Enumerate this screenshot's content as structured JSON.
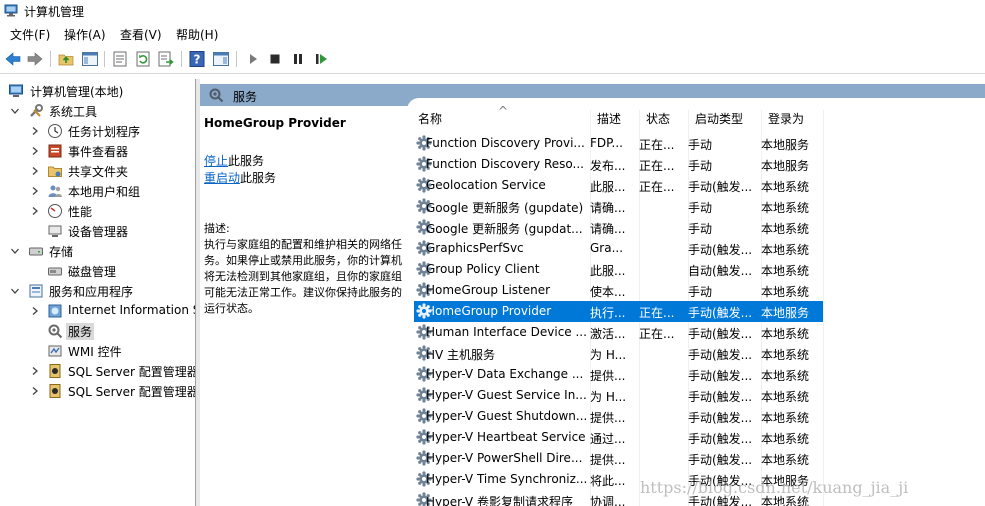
{
  "window": {
    "title": "计算机管理",
    "icon": "computer-management-icon"
  },
  "menu": [
    "文件(F)",
    "操作(A)",
    "查看(V)",
    "帮助(H)"
  ],
  "toolbar_icons": [
    "back-arrow-icon",
    "forward-arrow-icon",
    "up-folder-icon",
    "show-tree-icon",
    "properties-icon",
    "refresh-icon",
    "export-icon",
    "help-icon",
    "show-action-pane-icon",
    "play-icon",
    "stop-icon",
    "pause-icon",
    "resume-icon"
  ],
  "tree": {
    "root": "计算机管理(本地)",
    "system_tools": "系统工具",
    "task_scheduler": "任务计划程序",
    "event_viewer": "事件查看器",
    "shared_folders": "共享文件夹",
    "local_users": "本地用户和组",
    "performance": "性能",
    "device_manager": "设备管理器",
    "storage": "存储",
    "disk_management": "磁盘管理",
    "services_apps": "服务和应用程序",
    "iis": "Internet Information Services",
    "services": "服务",
    "wmi": "WMI 控件",
    "sql1": "SQL Server 配置管理器",
    "sql2": "SQL Server 配置管理器"
  },
  "band_title": "服务",
  "detail": {
    "service_name": "HomeGroup Provider",
    "stop_link": "停止",
    "stop_suffix": "此服务",
    "restart_link": "重启动",
    "restart_suffix": "此服务",
    "desc_label": "描述:",
    "desc_text": "执行与家庭组的配置和维护相关的网络任务。如果停止或禁用此服务，你的计算机将无法检测到其他家庭组，且你的家庭组可能无法正常工作。建议你保持此服务的运行状态。"
  },
  "columns": [
    "名称",
    "描述",
    "状态",
    "启动类型",
    "登录为"
  ],
  "sort_indicator": "^",
  "rows": [
    {
      "name": "Function Discovery Provi...",
      "desc": "FDP...",
      "status": "正在...",
      "startup": "手动",
      "logon": "本地服务"
    },
    {
      "name": "Function Discovery Reso...",
      "desc": "发布...",
      "status": "正在...",
      "startup": "手动",
      "logon": "本地服务"
    },
    {
      "name": "Geolocation Service",
      "desc": "此服...",
      "status": "正在...",
      "startup": "手动(触发...",
      "logon": "本地系统"
    },
    {
      "name": "Google 更新服务 (gupdate)",
      "desc": "请确...",
      "status": "",
      "startup": "手动",
      "logon": "本地系统"
    },
    {
      "name": "Google 更新服务 (gupdat...",
      "desc": "请确...",
      "status": "",
      "startup": "手动",
      "logon": "本地系统"
    },
    {
      "name": "GraphicsPerfSvc",
      "desc": "Gra...",
      "status": "",
      "startup": "手动(触发...",
      "logon": "本地系统"
    },
    {
      "name": "Group Policy Client",
      "desc": "此服...",
      "status": "",
      "startup": "自动(触发...",
      "logon": "本地系统"
    },
    {
      "name": "HomeGroup Listener",
      "desc": "使本...",
      "status": "",
      "startup": "手动",
      "logon": "本地系统"
    },
    {
      "name": "HomeGroup Provider",
      "desc": "执行...",
      "status": "正在...",
      "startup": "手动(触发...",
      "logon": "本地服务"
    },
    {
      "name": "Human Interface Device ...",
      "desc": "激活...",
      "status": "正在...",
      "startup": "手动(触发...",
      "logon": "本地系统"
    },
    {
      "name": "HV 主机服务",
      "desc": "为 H...",
      "status": "",
      "startup": "手动(触发...",
      "logon": "本地系统"
    },
    {
      "name": "Hyper-V Data Exchange ...",
      "desc": "提供...",
      "status": "",
      "startup": "手动(触发...",
      "logon": "本地系统"
    },
    {
      "name": "Hyper-V Guest Service In...",
      "desc": "为 H...",
      "status": "",
      "startup": "手动(触发...",
      "logon": "本地系统"
    },
    {
      "name": "Hyper-V Guest Shutdown...",
      "desc": "提供...",
      "status": "",
      "startup": "手动(触发...",
      "logon": "本地系统"
    },
    {
      "name": "Hyper-V Heartbeat Service",
      "desc": "通过...",
      "status": "",
      "startup": "手动(触发...",
      "logon": "本地系统"
    },
    {
      "name": "Hyper-V PowerShell Dire...",
      "desc": "提供...",
      "status": "",
      "startup": "手动(触发...",
      "logon": "本地系统"
    },
    {
      "name": "Hyper-V Time Synchroniz...",
      "desc": "将此...",
      "status": "",
      "startup": "手动(触发...",
      "logon": "本地服务"
    },
    {
      "name": "Hyper-V 卷影复制请求程序",
      "desc": "协调...",
      "status": "",
      "startup": "手动(触发...",
      "logon": "本地系统"
    }
  ],
  "selected_row": 8,
  "watermark": "https://blog.csdn.net/kuang_jia_ji",
  "colors": {
    "selection": "#0078d7",
    "band": "#8ba9c8",
    "link": "#0a64c8"
  }
}
